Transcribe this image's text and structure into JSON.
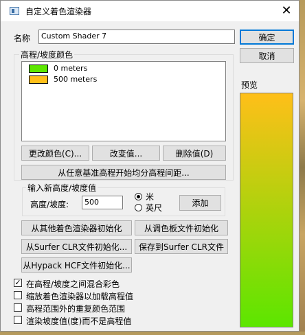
{
  "window": {
    "title": "自定义着色渲染器",
    "close_glyph": "✕"
  },
  "name_field": {
    "label": "名称",
    "value": "Custom Shader 7"
  },
  "buttons": {
    "ok": "确定",
    "cancel": "取消"
  },
  "elevation_group": {
    "title": "高程/坡度颜色",
    "items": [
      {
        "color": "#5ce600",
        "label": "0 meters"
      },
      {
        "color": "#ffbf19",
        "label": "500 meters"
      }
    ],
    "change_color": "更改颜色(C)...",
    "change_value": "改变值...",
    "delete_value": "删除值(D)",
    "equal_spacing": "从任意基准高程开始均分高程间距..."
  },
  "new_value_group": {
    "title": "输入新高度/坡度值",
    "height_label": "高度/坡度:",
    "height_value": "500",
    "unit_meter": "米",
    "unit_feet": "英尺",
    "unit_selected": "米",
    "add": "添加"
  },
  "init_buttons": {
    "from_other_shader": "从其他着色渲染器初始化",
    "from_palette": "从调色板文件初始化",
    "from_surfer_clr": "从Surfer CLR文件初始化...",
    "save_surfer_clr": "保存到Surfer CLR文件",
    "from_hypack_hcf": "从Hypack HCF文件初始化..."
  },
  "preview": {
    "label": "预览",
    "gradient_top": "#ffbf19",
    "gradient_bottom": "#5ce600"
  },
  "options": [
    {
      "label": "在高程/坡度之间混合彩色",
      "checked": true
    },
    {
      "label": "缩放着色渲染器以加载高程值",
      "checked": false
    },
    {
      "label": "高程范围外的重复颜色范围",
      "checked": false
    },
    {
      "label": "渲染坡度值(度)而不是高程值",
      "checked": false
    }
  ]
}
